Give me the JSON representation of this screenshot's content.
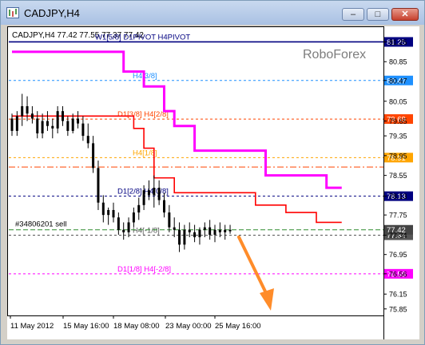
{
  "window": {
    "title": "CADJPY,H4",
    "minimize_glyph": "–",
    "maximize_glyph": "□",
    "close_glyph": "✕"
  },
  "header": {
    "symbol_info": "CADJPY,H4  77.42 77.55 77.37 77.42",
    "watermark": "RoboForex"
  },
  "colors": {
    "magenta": "#ff00ff",
    "red": "#ff0000",
    "navy": "#000080",
    "orange": "#ff8c2a"
  },
  "chart_data": {
    "type": "candlestick",
    "symbol": "CADJPY",
    "timeframe": "H4",
    "ohlc_header": {
      "open": 77.42,
      "high": 77.55,
      "low": 77.37,
      "close": 77.42
    },
    "y_axis": {
      "ticks": [
        81.25,
        80.85,
        80.47,
        80.05,
        79.65,
        79.35,
        78.95,
        78.55,
        78.13,
        77.75,
        77.34,
        76.95,
        76.56,
        76.15,
        75.85
      ],
      "ylim": [
        75.75,
        81.5
      ]
    },
    "x_axis": {
      "ticks": [
        "11 May 2012",
        "15 May 16:00",
        "18 May 08:00",
        "23 May 00:00",
        "25 May 16:00"
      ]
    },
    "levels": [
      {
        "label": "W1[5/8] D1PIVOT H4PIVOT",
        "price": 81.25,
        "color": "#000080",
        "style": "solid",
        "badge": "81.25"
      },
      {
        "label": "H4[3/8]",
        "price": 80.47,
        "color": "#1e90ff",
        "style": "dash",
        "badge": "80.47"
      },
      {
        "label": "D1[3/8] H4[2/8]",
        "price": 79.69,
        "color": "#ff4500",
        "style": "dash",
        "badge": "79.69"
      },
      {
        "label": "H4[1/8]",
        "price": 78.91,
        "color": "#ffa500",
        "style": "dash",
        "badge": "78.91"
      },
      {
        "label": "",
        "price": 78.72,
        "color": "#ff4500",
        "style": "dashdot",
        "badge": ""
      },
      {
        "label": "D1[2/8] H4[0/8]",
        "price": 78.13,
        "color": "#000080",
        "style": "dash",
        "badge": "78.13"
      },
      {
        "label": "H4[-1/8]",
        "price": 77.34,
        "color": "#555555",
        "style": "dash",
        "badge": "77.34"
      },
      {
        "label": "D1[1/8] H4[-2/8]",
        "price": 76.56,
        "color": "#ff00ff",
        "style": "dash",
        "badge": "76.56"
      }
    ],
    "trade": {
      "label": "#34806201 sell",
      "price": 77.45,
      "color": "#2e8b2e",
      "badge": "77.42"
    },
    "candles": [
      {
        "o": 79.7,
        "h": 79.8,
        "l": 79.35,
        "c": 79.45
      },
      {
        "o": 79.45,
        "h": 79.85,
        "l": 79.35,
        "c": 79.75
      },
      {
        "o": 79.75,
        "h": 80.2,
        "l": 79.55,
        "c": 79.95
      },
      {
        "o": 79.95,
        "h": 80.15,
        "l": 79.65,
        "c": 79.8
      },
      {
        "o": 79.8,
        "h": 79.95,
        "l": 79.6,
        "c": 79.7
      },
      {
        "o": 79.7,
        "h": 79.85,
        "l": 79.3,
        "c": 79.4
      },
      {
        "o": 79.4,
        "h": 79.8,
        "l": 79.3,
        "c": 79.65
      },
      {
        "o": 79.65,
        "h": 79.85,
        "l": 79.45,
        "c": 79.55
      },
      {
        "o": 79.55,
        "h": 79.7,
        "l": 79.3,
        "c": 79.5
      },
      {
        "o": 79.5,
        "h": 79.95,
        "l": 79.4,
        "c": 79.85
      },
      {
        "o": 79.85,
        "h": 79.95,
        "l": 79.55,
        "c": 79.65
      },
      {
        "o": 79.65,
        "h": 79.75,
        "l": 79.35,
        "c": 79.45
      },
      {
        "o": 79.45,
        "h": 79.8,
        "l": 79.4,
        "c": 79.7
      },
      {
        "o": 79.7,
        "h": 79.85,
        "l": 79.5,
        "c": 79.6
      },
      {
        "o": 79.6,
        "h": 79.75,
        "l": 79.25,
        "c": 79.35
      },
      {
        "o": 79.35,
        "h": 79.6,
        "l": 79.1,
        "c": 79.2
      },
      {
        "o": 79.2,
        "h": 79.35,
        "l": 78.6,
        "c": 78.7
      },
      {
        "o": 78.7,
        "h": 78.85,
        "l": 77.85,
        "c": 78.0
      },
      {
        "o": 78.0,
        "h": 78.15,
        "l": 77.6,
        "c": 77.75
      },
      {
        "o": 77.75,
        "h": 77.9,
        "l": 77.55,
        "c": 77.85
      },
      {
        "o": 77.85,
        "h": 78.0,
        "l": 77.6,
        "c": 77.7
      },
      {
        "o": 77.7,
        "h": 77.8,
        "l": 77.35,
        "c": 77.45
      },
      {
        "o": 77.45,
        "h": 77.6,
        "l": 77.25,
        "c": 77.4
      },
      {
        "o": 77.4,
        "h": 77.7,
        "l": 77.3,
        "c": 77.6
      },
      {
        "o": 77.6,
        "h": 77.9,
        "l": 77.5,
        "c": 77.8
      },
      {
        "o": 77.8,
        "h": 78.1,
        "l": 77.65,
        "c": 77.95
      },
      {
        "o": 77.95,
        "h": 78.35,
        "l": 77.85,
        "c": 78.25
      },
      {
        "o": 78.25,
        "h": 78.45,
        "l": 78.05,
        "c": 78.15
      },
      {
        "o": 78.15,
        "h": 78.55,
        "l": 77.9,
        "c": 78.3
      },
      {
        "o": 78.3,
        "h": 78.45,
        "l": 77.95,
        "c": 78.05
      },
      {
        "o": 78.05,
        "h": 78.2,
        "l": 77.7,
        "c": 77.8
      },
      {
        "o": 77.8,
        "h": 77.95,
        "l": 77.4,
        "c": 77.5
      },
      {
        "o": 77.5,
        "h": 77.7,
        "l": 77.3,
        "c": 77.45
      },
      {
        "o": 77.45,
        "h": 77.6,
        "l": 77.0,
        "c": 77.15
      },
      {
        "o": 77.15,
        "h": 77.55,
        "l": 77.05,
        "c": 77.45
      },
      {
        "o": 77.45,
        "h": 77.6,
        "l": 77.3,
        "c": 77.4
      },
      {
        "o": 77.4,
        "h": 77.55,
        "l": 77.2,
        "c": 77.3
      },
      {
        "o": 77.3,
        "h": 77.5,
        "l": 77.15,
        "c": 77.45
      },
      {
        "o": 77.45,
        "h": 77.6,
        "l": 77.3,
        "c": 77.5
      },
      {
        "o": 77.5,
        "h": 77.65,
        "l": 77.25,
        "c": 77.35
      },
      {
        "o": 77.35,
        "h": 77.55,
        "l": 77.2,
        "c": 77.45
      },
      {
        "o": 77.45,
        "h": 77.6,
        "l": 77.3,
        "c": 77.4
      },
      {
        "o": 77.4,
        "h": 77.55,
        "l": 77.25,
        "c": 77.45
      },
      {
        "o": 77.45,
        "h": 77.55,
        "l": 77.37,
        "c": 77.42
      }
    ],
    "step_lines": [
      {
        "name": "H4 upper",
        "color": "#ff00ff",
        "points": [
          [
            0,
            81.05
          ],
          [
            22,
            81.05
          ],
          [
            22,
            80.65
          ],
          [
            26,
            80.65
          ],
          [
            26,
            80.35
          ],
          [
            30,
            80.35
          ],
          [
            30,
            79.85
          ],
          [
            32,
            79.85
          ],
          [
            32,
            79.55
          ],
          [
            36,
            79.55
          ],
          [
            36,
            79.05
          ],
          [
            50,
            79.05
          ],
          [
            50,
            78.55
          ],
          [
            62,
            78.55
          ],
          [
            62,
            78.3
          ],
          [
            65,
            78.3
          ]
        ]
      },
      {
        "name": "D1 mid",
        "color": "#ff0000",
        "points": [
          [
            0,
            79.75
          ],
          [
            24,
            79.75
          ],
          [
            24,
            79.5
          ],
          [
            26,
            79.5
          ],
          [
            26,
            79.1
          ],
          [
            28,
            79.1
          ],
          [
            28,
            78.5
          ],
          [
            32,
            78.5
          ],
          [
            32,
            78.2
          ],
          [
            48,
            78.2
          ],
          [
            48,
            77.95
          ],
          [
            54,
            77.95
          ],
          [
            54,
            77.8
          ],
          [
            60,
            77.8
          ],
          [
            60,
            77.6
          ],
          [
            65,
            77.6
          ]
        ]
      }
    ],
    "forecast_arrow": {
      "from": [
        66,
        77.4
      ],
      "to": [
        76,
        75.95
      ],
      "direction": "down"
    }
  }
}
